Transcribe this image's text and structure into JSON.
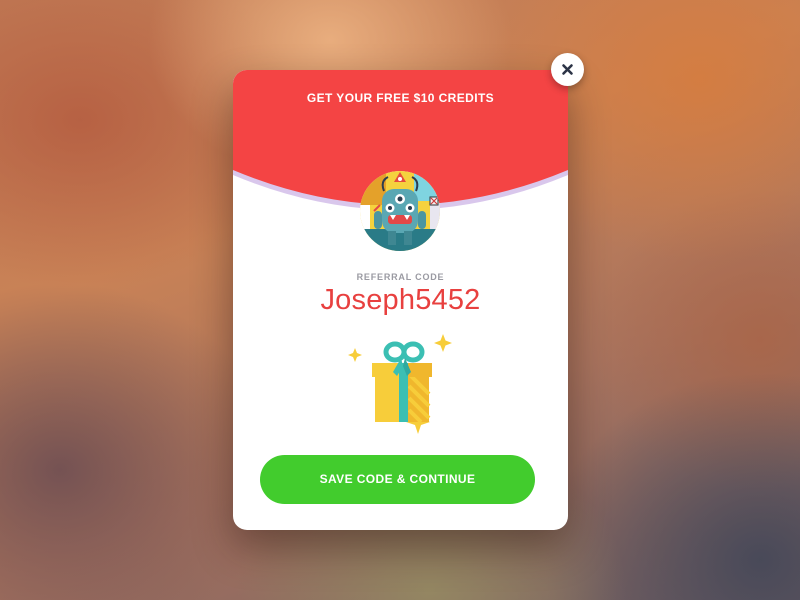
{
  "modal": {
    "title": "GET YOUR FREE $10 CREDITS",
    "referral_label": "REFERRAL CODE",
    "referral_code": "Joseph5452",
    "cta_label": "SAVE CODE & CONTINUE"
  },
  "icons": {
    "close": "close-icon",
    "avatar": "monster-avatar",
    "gift": "gift-icon"
  },
  "colors": {
    "header_red": "#f44444",
    "code_red": "#e8403f",
    "cta_green": "#42cc2d",
    "gift_yellow": "#f7cd3a",
    "ribbon_teal": "#3bbfb3"
  }
}
